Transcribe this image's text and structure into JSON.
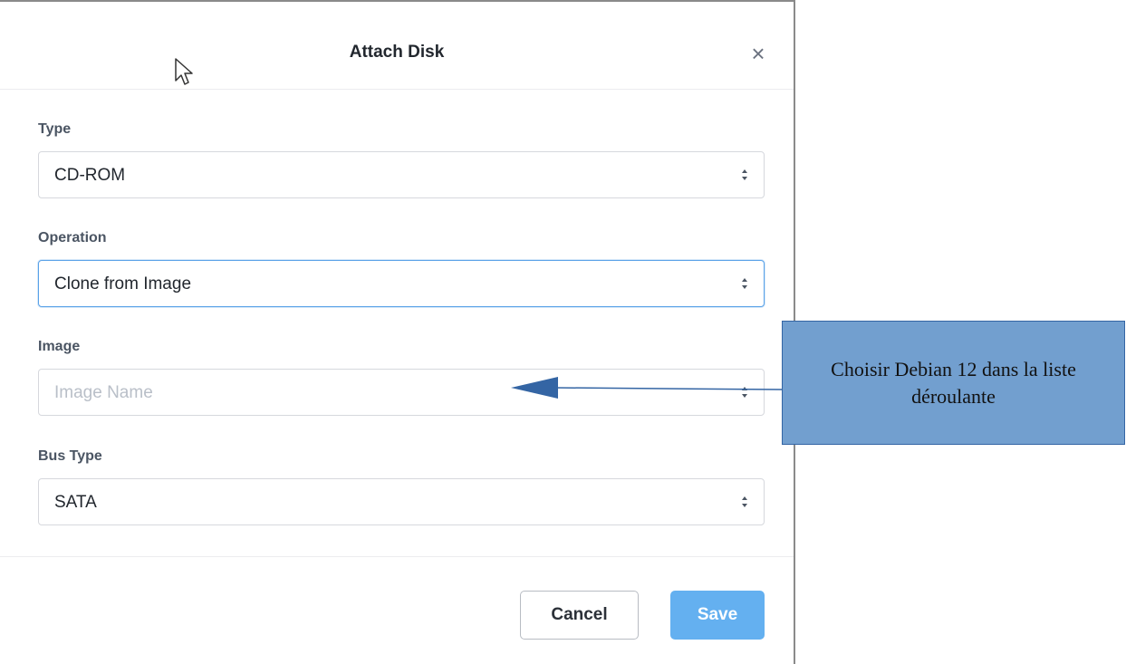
{
  "dialog": {
    "title": "Attach Disk",
    "close_icon": "close-icon",
    "close_label": "×"
  },
  "fields": {
    "type": {
      "label": "Type",
      "value": "CD-ROM"
    },
    "operation": {
      "label": "Operation",
      "value": "Clone from Image"
    },
    "image": {
      "label": "Image",
      "value": "",
      "placeholder": "Image Name"
    },
    "bus_type": {
      "label": "Bus Type",
      "value": "SATA"
    }
  },
  "footer": {
    "cancel_label": "Cancel",
    "save_label": "Save"
  },
  "annotation": {
    "text": "Choisir Debian 12 dans la liste déroulante"
  },
  "colors": {
    "primary": "#64b0f0",
    "focus_border": "#5aa2e8",
    "callout_fill": "#729fcf",
    "callout_border": "#3465a4",
    "arrow": "#3465a4"
  }
}
